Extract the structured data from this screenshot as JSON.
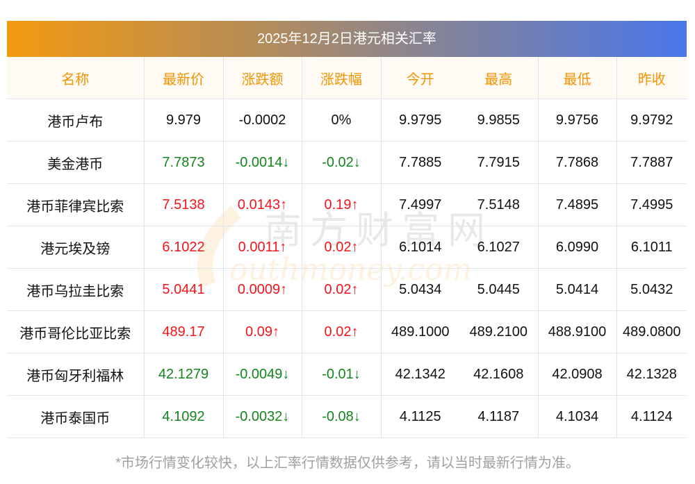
{
  "title": "2025年12月2日港元相关汇率",
  "headers": [
    "名称",
    "最新价",
    "涨跌额",
    "涨跌幅",
    "今开",
    "最高",
    "最低",
    "昨收"
  ],
  "rows": [
    {
      "name": "港币卢布",
      "latest": "9.979",
      "change": "-0.0002",
      "pct": "0%",
      "open": "9.9795",
      "high": "9.9855",
      "low": "9.9756",
      "prev": "9.9792",
      "dir": "flat"
    },
    {
      "name": "美金港币",
      "latest": "7.7873",
      "change": "-0.0014↓",
      "pct": "-0.02↓",
      "open": "7.7885",
      "high": "7.7915",
      "low": "7.7868",
      "prev": "7.7887",
      "dir": "down"
    },
    {
      "name": "港币菲律宾比索",
      "latest": "7.5138",
      "change": "0.0143↑",
      "pct": "0.19↑",
      "open": "7.4997",
      "high": "7.5148",
      "low": "7.4895",
      "prev": "7.4995",
      "dir": "up"
    },
    {
      "name": "港元埃及镑",
      "latest": "6.1022",
      "change": "0.0011↑",
      "pct": "0.02↑",
      "open": "6.1014",
      "high": "6.1027",
      "low": "6.0990",
      "prev": "6.1011",
      "dir": "up"
    },
    {
      "name": "港币乌拉圭比索",
      "latest": "5.0441",
      "change": "0.0009↑",
      "pct": "0.02↑",
      "open": "5.0434",
      "high": "5.0445",
      "low": "5.0414",
      "prev": "5.0432",
      "dir": "up"
    },
    {
      "name": "港币哥伦比亚比索",
      "latest": "489.17",
      "change": "0.09↑",
      "pct": "0.02↑",
      "open": "489.1000",
      "high": "489.2100",
      "low": "488.9100",
      "prev": "489.0800",
      "dir": "up"
    },
    {
      "name": "港币匈牙利福林",
      "latest": "42.1279",
      "change": "-0.0049↓",
      "pct": "-0.01↓",
      "open": "42.1342",
      "high": "42.1608",
      "low": "42.0908",
      "prev": "42.1328",
      "dir": "down"
    },
    {
      "name": "港币泰国币",
      "latest": "4.1092",
      "change": "-0.0032↓",
      "pct": "-0.08↓",
      "open": "4.1125",
      "high": "4.1187",
      "low": "4.1034",
      "prev": "4.1124",
      "dir": "down"
    }
  ],
  "footer": "*市场行情变化较快，以上汇率行情数据仅供参考，请以当时最新行情为准。",
  "watermark": {
    "cn": "南方财富网",
    "en": "southmoney.com"
  },
  "colors": {
    "up": "#f5141a",
    "down": "#14851c",
    "header": "#f39400"
  }
}
